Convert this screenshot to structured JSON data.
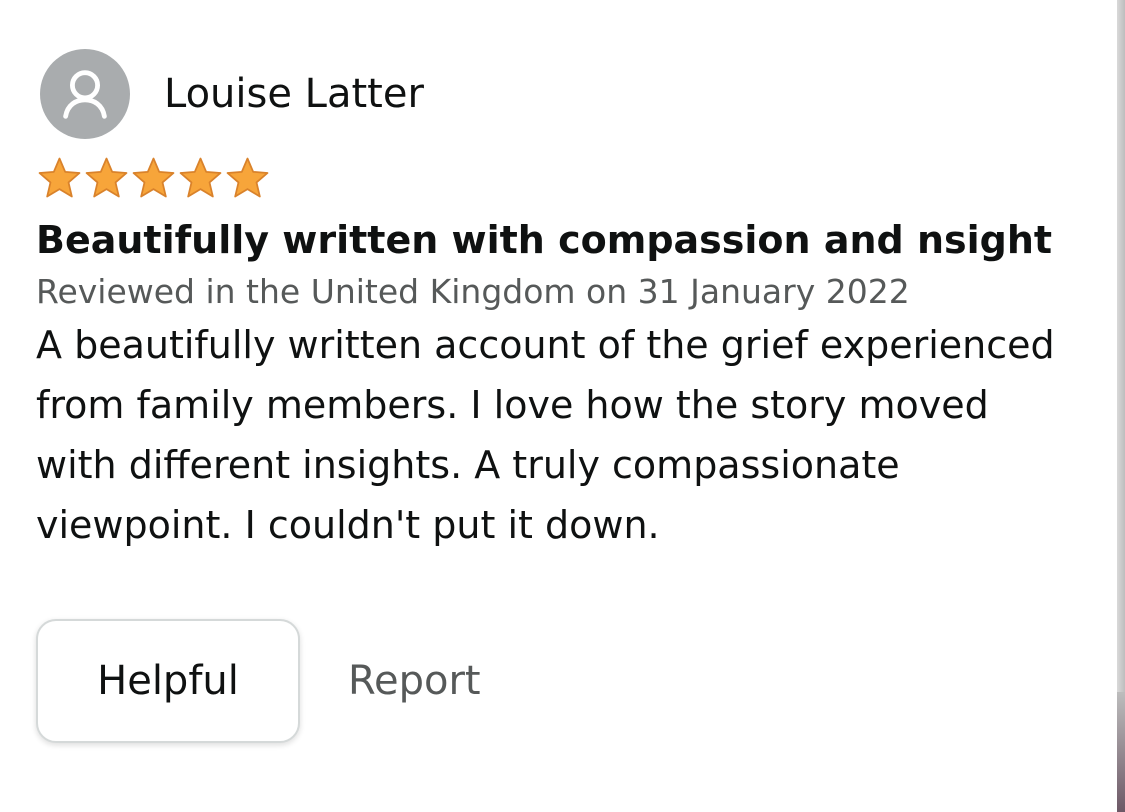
{
  "review": {
    "reviewer_name": "Louise Latter",
    "rating": 5,
    "rating_max": 5,
    "title": "Beautifully written with compassion and nsight",
    "meta": "Reviewed in the United Kingdom on 31 January 2022",
    "body": "A beautifully written account of the grief experienced from family members. I love how the story moved with different insights. A truly compassionate viewpoint. I couldn't put it down."
  },
  "actions": {
    "helpful_label": "Helpful",
    "report_label": "Report"
  },
  "icons": {
    "avatar": "user-avatar-icon",
    "star": "star-icon"
  },
  "colors": {
    "star": "#f7a53a",
    "avatar_bg": "#a9acae",
    "meta_text": "#565959"
  }
}
